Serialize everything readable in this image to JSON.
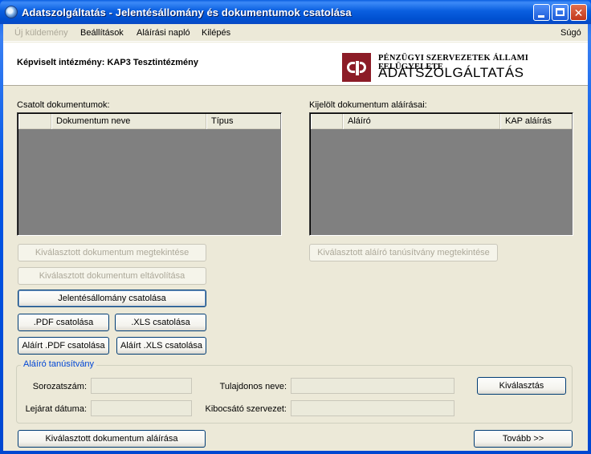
{
  "window": {
    "title": "Adatszolgáltatás - Jelentésállomány és dokumentumok csatolása",
    "icon": "app-globe-icon"
  },
  "menu": {
    "items": [
      "Új küldemény",
      "Beállítások",
      "Aláírási napló",
      "Kilépés"
    ],
    "help": "Súgó"
  },
  "header": {
    "represented": "Képviselt intézmény: KAP3 Tesztintézmény",
    "org_name": "PÉNZÜGYI SZERVEZETEK ÁLLAMI FELÜGYELETE",
    "org_sub": "ADATSZOLGÁLTATÁS"
  },
  "attached_docs": {
    "label": "Csatolt dokumentumok:",
    "columns": [
      "",
      "Dokumentum neve",
      "Típus"
    ],
    "rows": []
  },
  "signatures": {
    "label": "Kijelölt dokumentum aláírásai:",
    "columns": [
      "",
      "Aláíró",
      "KAP aláírás"
    ],
    "rows": []
  },
  "buttons": {
    "view_doc": "Kiválasztott dokumentum megtekintése",
    "remove_doc": "Kiválasztott dokumentum eltávolítása",
    "attach_report": "Jelentésállomány csatolása",
    "attach_pdf": ".PDF csatolása",
    "attach_xls": ".XLS csatolása",
    "attach_signed_pdf": "Aláírt .PDF csatolása",
    "attach_signed_xls": "Aláírt .XLS csatolása",
    "view_cert": "Kiválasztott aláíró tanúsítvány megtekintése",
    "select": "Kiválasztás",
    "sign_doc": "Kiválasztott dokumentum aláírása",
    "next": "Tovább >>"
  },
  "certificate": {
    "legend": "Aláíró tanúsítvány",
    "serial_label": "Sorozatszám:",
    "serial_value": "",
    "expiry_label": "Lejárat dátuma:",
    "expiry_value": "",
    "owner_label": "Tulajdonos neve:",
    "owner_value": "",
    "issuer_label": "Kibocsátó szervezet:",
    "issuer_value": ""
  }
}
